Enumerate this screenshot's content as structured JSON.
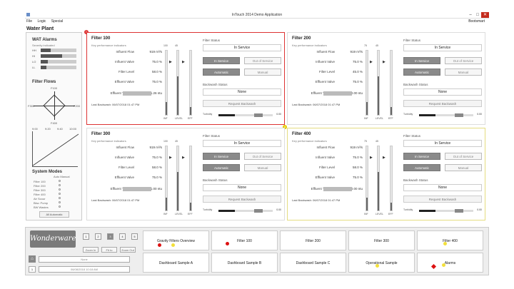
{
  "window": {
    "title": "InTouch 2014 Demo Application",
    "menu": [
      "File",
      "Logic",
      "Special"
    ],
    "menu_right": "Bootsmart",
    "page_title": "Water Plant"
  },
  "left": {
    "alarms_title": "WAT Alarms",
    "alarms_sub": "Severity indicated",
    "alarm_rows": [
      "HH",
      "HI",
      "LO",
      "LL"
    ],
    "filter_flows": "Filter Flows",
    "north": "F100",
    "west": "F300",
    "east": "F200",
    "south": "F400",
    "modes_title": "System Modes",
    "modes": [
      "Filter 100",
      "Filter 200",
      "Filter 300",
      "Filter 400",
      "Air Scour",
      "Bkw. Pump",
      "BW Wastes"
    ],
    "modes_head": "Auto Manual",
    "all_button": "All Automatic",
    "trend_labels": [
      "9:00",
      "9:20",
      "9:40",
      "10:00"
    ]
  },
  "panels": [
    {
      "id": "f100",
      "title": "Filter 100",
      "sub": "Key performance indicators",
      "rows": [
        {
          "label": "Influent Flow",
          "value": "919 m³/s"
        },
        {
          "label": "Influent Valve",
          "value": "75.0 %"
        },
        {
          "label": "Filter Level",
          "value": "58.0 %"
        },
        {
          "label": "Effluent Valve",
          "value": "75.0 %"
        },
        {
          "label": "Effluent Turbidity",
          "value": "1.26 ntu"
        }
      ],
      "last_bw": "Last Backwash: 06/07/2018 01:47 PM",
      "status_label": "Filter Status",
      "status": "In Service",
      "auto": "In Service",
      "manual_alt": "Out of Service",
      "auto2": "Automatic",
      "manual": "Manual",
      "bw_label": "Backwash Status",
      "bw": "None",
      "request": "Request Backwash",
      "tank_tops": [
        "100",
        "45",
        ""
      ],
      "tank_bots": [
        "INF",
        "LEVEL",
        "EFF"
      ],
      "turb_label": "Turbidity",
      "turb_val": "0.00"
    },
    {
      "id": "f200",
      "title": "Filter 200",
      "sub": "Key performance indicators",
      "rows": [
        {
          "label": "Influent Flow",
          "value": "919 m³/s"
        },
        {
          "label": "Influent Valve",
          "value": "75.0 %"
        },
        {
          "label": "Filter Level",
          "value": "45.0 %"
        },
        {
          "label": "Effluent Valve",
          "value": "75.0 %"
        },
        {
          "label": "Effluent Turbidity",
          "value": "0.00 ntu"
        }
      ],
      "last_bw": "Last Backwash: 06/07/2018 01:47 PM",
      "status_label": "Filter Status",
      "status": "In Service",
      "auto": "In Service",
      "manual_alt": "Out of Service",
      "auto2": "Automatic",
      "manual": "Manual",
      "bw_label": "Backwash Status",
      "bw": "None",
      "request": "Request Backwash",
      "tank_tops": [
        "75",
        "45",
        ""
      ],
      "tank_bots": [
        "INF",
        "LEVEL",
        "EFF"
      ],
      "turb_label": "Turbidity",
      "turb_val": "0.00"
    },
    {
      "id": "f300",
      "title": "Filter 300",
      "sub": "Key performance indicators",
      "rows": [
        {
          "label": "Influent Flow",
          "value": "919 m³/s"
        },
        {
          "label": "Influent Valve",
          "value": "75.0 %"
        },
        {
          "label": "Filter Level",
          "value": "58.0 %"
        },
        {
          "label": "Effluent Valve",
          "value": "75.0 %"
        },
        {
          "label": "Effluent Turbidity",
          "value": "1.00 ntu"
        }
      ],
      "last_bw": "Last Backwash: 06/07/2018 01:47 PM",
      "status_label": "Filter Status",
      "status": "In Service",
      "auto": "In Service",
      "manual_alt": "Out of Service",
      "auto2": "Automatic",
      "manual": "Manual",
      "bw_label": "Backwash Status",
      "bw": "None",
      "request": "Request Backwash",
      "tank_tops": [
        "100",
        "45",
        ""
      ],
      "tank_bots": [
        "INF",
        "LEVEL",
        "EFF"
      ],
      "turb_label": "Turbidity",
      "turb_val": "0.00"
    },
    {
      "id": "f400",
      "title": "Filter 400",
      "sub": "Key performance indicators",
      "rows": [
        {
          "label": "Influent Flow",
          "value": "919 m³/s"
        },
        {
          "label": "Influent Valve",
          "value": "75.0 %"
        },
        {
          "label": "Filter Level",
          "value": "58.0 %"
        },
        {
          "label": "Effluent Valve",
          "value": "75.0 %"
        },
        {
          "label": "Effluent Turbidity",
          "value": "0.00 ntu"
        }
      ],
      "last_bw": "Last Backwash: 06/07/2018 01:47 PM",
      "status_label": "Filter Status",
      "status": "In Service",
      "auto": "In Service",
      "manual_alt": "Out of Service",
      "auto2": "Automatic",
      "manual": "Manual",
      "bw_label": "Backwash Status",
      "bw": "None",
      "request": "Request Backwash",
      "tank_tops": [
        "75",
        "45",
        ""
      ],
      "tank_bots": [
        "INF",
        "LEVEL",
        "EFF"
      ],
      "turb_label": "Turbidity",
      "turb_val": "0.00"
    }
  ],
  "bottom": {
    "logo": "Wonderware",
    "pages": [
      "1",
      "2",
      "3",
      "4",
      "5"
    ],
    "active_page": "3",
    "zoom": [
      "Zoom In",
      "Fit to",
      "Zoom Out"
    ],
    "node": "None",
    "num": "1",
    "date": "06/08/2018 10:18 AM",
    "tiles": [
      "Gravity Filters Overview",
      "Filter 100",
      "Filter 200",
      "Filter 300",
      "Filter 400",
      "Dashboard Sample A",
      "Dashboard Sample B",
      "Dashboard Sample C",
      "Operational Sample",
      "Alarms"
    ]
  },
  "colors": {
    "alarm_red": "#d33",
    "alert_yellow": "#e5dd80"
  }
}
